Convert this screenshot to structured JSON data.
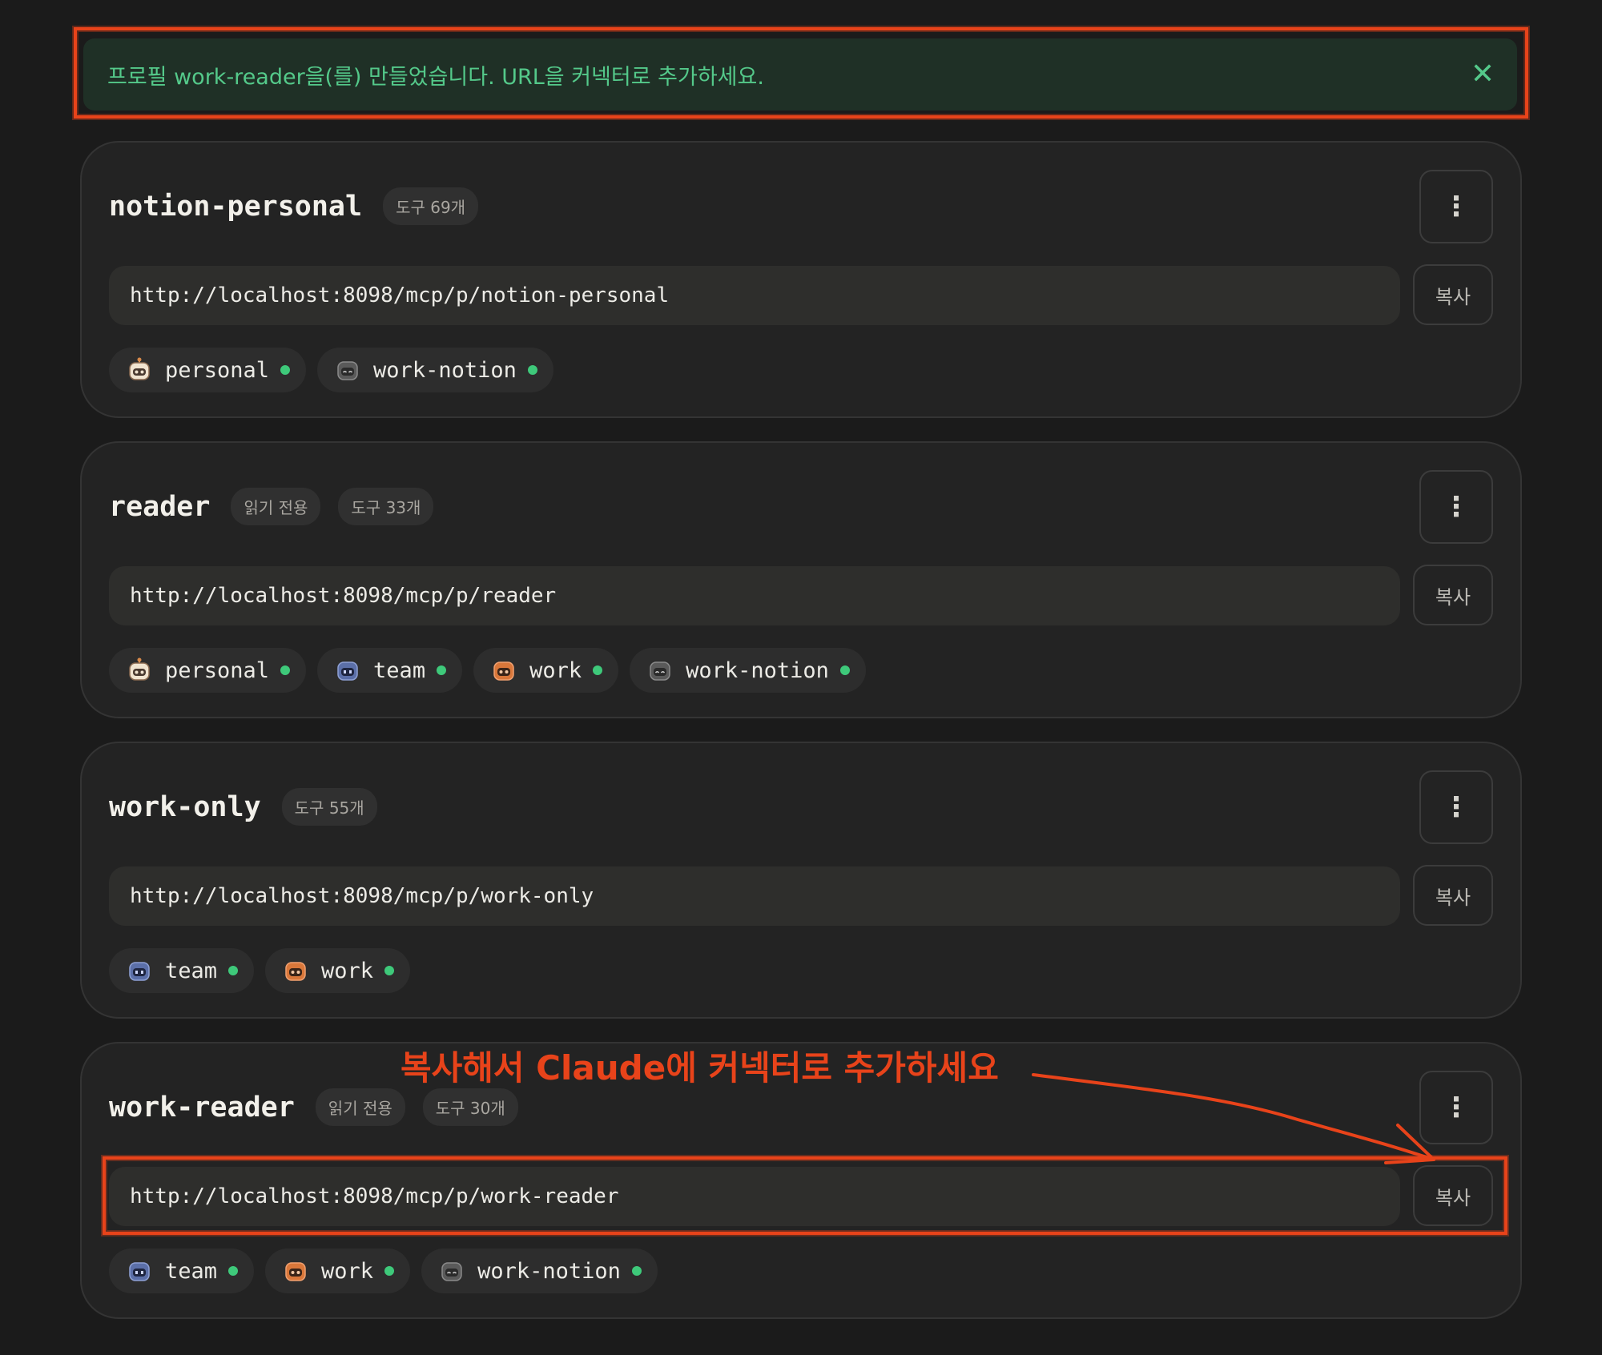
{
  "banner": {
    "message": "프로필 work-reader을(를) 만들었습니다. URL을 커넥터로 추가하세요.",
    "close_glyph": "✕"
  },
  "annotation": {
    "text": "복사해서 Claude에 커넥터로 추가하세요",
    "color": "#e8431a"
  },
  "profiles": [
    {
      "name": "notion-personal",
      "badges": [
        "도구 69개"
      ],
      "url": "http://localhost:8098/mcp/p/notion-personal",
      "copy_label": "복사",
      "menu_glyph": "⋮",
      "connectors": [
        {
          "label": "personal",
          "icon": "robot-personal-icon"
        },
        {
          "label": "work-notion",
          "icon": "robot-work-notion-icon"
        }
      ]
    },
    {
      "name": "reader",
      "badges": [
        "읽기 전용",
        "도구 33개"
      ],
      "url": "http://localhost:8098/mcp/p/reader",
      "copy_label": "복사",
      "menu_glyph": "⋮",
      "connectors": [
        {
          "label": "personal",
          "icon": "robot-personal-icon"
        },
        {
          "label": "team",
          "icon": "robot-team-icon"
        },
        {
          "label": "work",
          "icon": "robot-work-icon"
        },
        {
          "label": "work-notion",
          "icon": "robot-work-notion-icon"
        }
      ]
    },
    {
      "name": "work-only",
      "badges": [
        "도구 55개"
      ],
      "url": "http://localhost:8098/mcp/p/work-only",
      "copy_label": "복사",
      "menu_glyph": "⋮",
      "connectors": [
        {
          "label": "team",
          "icon": "robot-team-icon"
        },
        {
          "label": "work",
          "icon": "robot-work-icon"
        }
      ]
    },
    {
      "name": "work-reader",
      "badges": [
        "읽기 전용",
        "도구 30개"
      ],
      "url": "http://localhost:8098/mcp/p/work-reader",
      "copy_label": "복사",
      "menu_glyph": "⋮",
      "connectors": [
        {
          "label": "team",
          "icon": "robot-team-icon"
        },
        {
          "label": "work",
          "icon": "robot-work-icon"
        },
        {
          "label": "work-notion",
          "icon": "robot-work-notion-icon"
        }
      ]
    }
  ],
  "colors": {
    "status_active": "#3ec97a",
    "banner_text": "#54c98a",
    "banner_bg": "#1f3026",
    "annotation": "#e8431a"
  }
}
